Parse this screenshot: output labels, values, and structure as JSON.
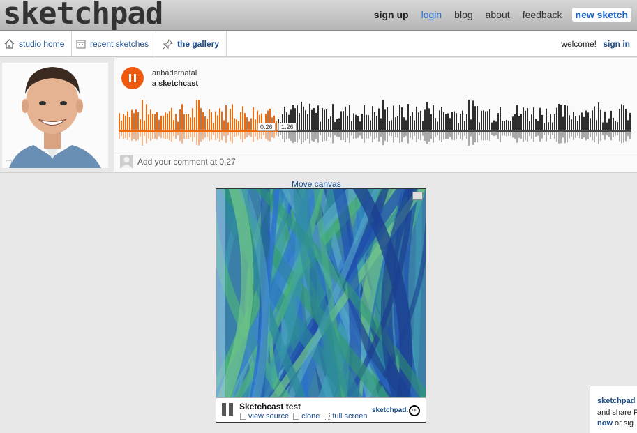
{
  "header": {
    "logo": "sketchpad",
    "nav": {
      "sign_up": "sign up",
      "login": "login",
      "blog": "blog",
      "about": "about",
      "feedback": "feedback",
      "new_sketch": "new sketch"
    }
  },
  "subnav": {
    "tabs": [
      {
        "label": "studio home",
        "icon": "house-icon"
      },
      {
        "label": "recent sketches",
        "icon": "calendar-icon"
      },
      {
        "label": "the gallery",
        "icon": "pin-icon"
      }
    ],
    "welcome": "welcome!",
    "sign_in": "sign in"
  },
  "player": {
    "user": "aribadernatal",
    "title": "a sketchcast",
    "current_time": "0.26",
    "total_time": "1.26",
    "progress": 0.31,
    "comment_placeholder": "Add your comment at 0.27",
    "colors": {
      "played": "#ee6a0f",
      "unplayed": "#2e2e2e"
    }
  },
  "canvas": {
    "move_label": "Move canvas",
    "title": "Sketchcast test",
    "links": {
      "view_source": "view source",
      "clone": "clone",
      "full_screen": "full screen"
    },
    "brand": "sketchpad.",
    "license": "cc"
  },
  "side_popup": {
    "line1": "sketchpad",
    "line2": "and share P",
    "line3_bold": "now",
    "line3_rest": " or sig"
  }
}
